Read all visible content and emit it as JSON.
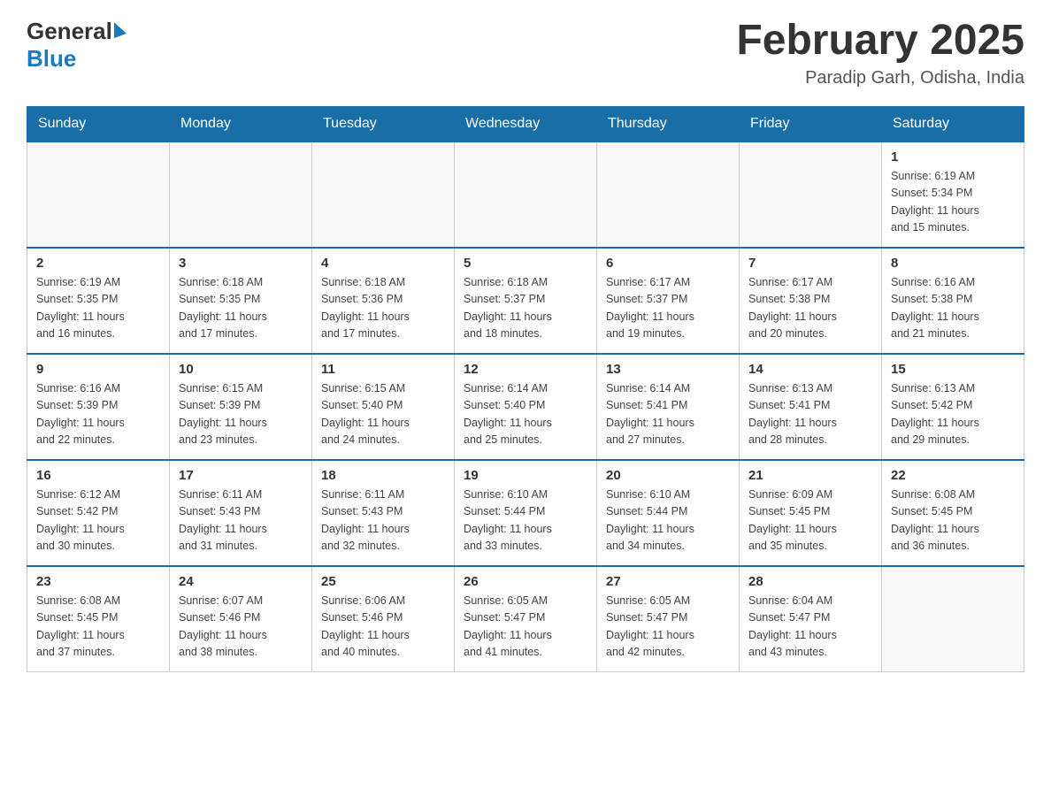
{
  "header": {
    "logo_general": "General",
    "logo_blue": "Blue",
    "month_title": "February 2025",
    "location": "Paradip Garh, Odisha, India"
  },
  "days_of_week": [
    "Sunday",
    "Monday",
    "Tuesday",
    "Wednesday",
    "Thursday",
    "Friday",
    "Saturday"
  ],
  "weeks": [
    [
      {
        "day": "",
        "info": ""
      },
      {
        "day": "",
        "info": ""
      },
      {
        "day": "",
        "info": ""
      },
      {
        "day": "",
        "info": ""
      },
      {
        "day": "",
        "info": ""
      },
      {
        "day": "",
        "info": ""
      },
      {
        "day": "1",
        "info": "Sunrise: 6:19 AM\nSunset: 5:34 PM\nDaylight: 11 hours\nand 15 minutes."
      }
    ],
    [
      {
        "day": "2",
        "info": "Sunrise: 6:19 AM\nSunset: 5:35 PM\nDaylight: 11 hours\nand 16 minutes."
      },
      {
        "day": "3",
        "info": "Sunrise: 6:18 AM\nSunset: 5:35 PM\nDaylight: 11 hours\nand 17 minutes."
      },
      {
        "day": "4",
        "info": "Sunrise: 6:18 AM\nSunset: 5:36 PM\nDaylight: 11 hours\nand 17 minutes."
      },
      {
        "day": "5",
        "info": "Sunrise: 6:18 AM\nSunset: 5:37 PM\nDaylight: 11 hours\nand 18 minutes."
      },
      {
        "day": "6",
        "info": "Sunrise: 6:17 AM\nSunset: 5:37 PM\nDaylight: 11 hours\nand 19 minutes."
      },
      {
        "day": "7",
        "info": "Sunrise: 6:17 AM\nSunset: 5:38 PM\nDaylight: 11 hours\nand 20 minutes."
      },
      {
        "day": "8",
        "info": "Sunrise: 6:16 AM\nSunset: 5:38 PM\nDaylight: 11 hours\nand 21 minutes."
      }
    ],
    [
      {
        "day": "9",
        "info": "Sunrise: 6:16 AM\nSunset: 5:39 PM\nDaylight: 11 hours\nand 22 minutes."
      },
      {
        "day": "10",
        "info": "Sunrise: 6:15 AM\nSunset: 5:39 PM\nDaylight: 11 hours\nand 23 minutes."
      },
      {
        "day": "11",
        "info": "Sunrise: 6:15 AM\nSunset: 5:40 PM\nDaylight: 11 hours\nand 24 minutes."
      },
      {
        "day": "12",
        "info": "Sunrise: 6:14 AM\nSunset: 5:40 PM\nDaylight: 11 hours\nand 25 minutes."
      },
      {
        "day": "13",
        "info": "Sunrise: 6:14 AM\nSunset: 5:41 PM\nDaylight: 11 hours\nand 27 minutes."
      },
      {
        "day": "14",
        "info": "Sunrise: 6:13 AM\nSunset: 5:41 PM\nDaylight: 11 hours\nand 28 minutes."
      },
      {
        "day": "15",
        "info": "Sunrise: 6:13 AM\nSunset: 5:42 PM\nDaylight: 11 hours\nand 29 minutes."
      }
    ],
    [
      {
        "day": "16",
        "info": "Sunrise: 6:12 AM\nSunset: 5:42 PM\nDaylight: 11 hours\nand 30 minutes."
      },
      {
        "day": "17",
        "info": "Sunrise: 6:11 AM\nSunset: 5:43 PM\nDaylight: 11 hours\nand 31 minutes."
      },
      {
        "day": "18",
        "info": "Sunrise: 6:11 AM\nSunset: 5:43 PM\nDaylight: 11 hours\nand 32 minutes."
      },
      {
        "day": "19",
        "info": "Sunrise: 6:10 AM\nSunset: 5:44 PM\nDaylight: 11 hours\nand 33 minutes."
      },
      {
        "day": "20",
        "info": "Sunrise: 6:10 AM\nSunset: 5:44 PM\nDaylight: 11 hours\nand 34 minutes."
      },
      {
        "day": "21",
        "info": "Sunrise: 6:09 AM\nSunset: 5:45 PM\nDaylight: 11 hours\nand 35 minutes."
      },
      {
        "day": "22",
        "info": "Sunrise: 6:08 AM\nSunset: 5:45 PM\nDaylight: 11 hours\nand 36 minutes."
      }
    ],
    [
      {
        "day": "23",
        "info": "Sunrise: 6:08 AM\nSunset: 5:45 PM\nDaylight: 11 hours\nand 37 minutes."
      },
      {
        "day": "24",
        "info": "Sunrise: 6:07 AM\nSunset: 5:46 PM\nDaylight: 11 hours\nand 38 minutes."
      },
      {
        "day": "25",
        "info": "Sunrise: 6:06 AM\nSunset: 5:46 PM\nDaylight: 11 hours\nand 40 minutes."
      },
      {
        "day": "26",
        "info": "Sunrise: 6:05 AM\nSunset: 5:47 PM\nDaylight: 11 hours\nand 41 minutes."
      },
      {
        "day": "27",
        "info": "Sunrise: 6:05 AM\nSunset: 5:47 PM\nDaylight: 11 hours\nand 42 minutes."
      },
      {
        "day": "28",
        "info": "Sunrise: 6:04 AM\nSunset: 5:47 PM\nDaylight: 11 hours\nand 43 minutes."
      },
      {
        "day": "",
        "info": ""
      }
    ]
  ]
}
